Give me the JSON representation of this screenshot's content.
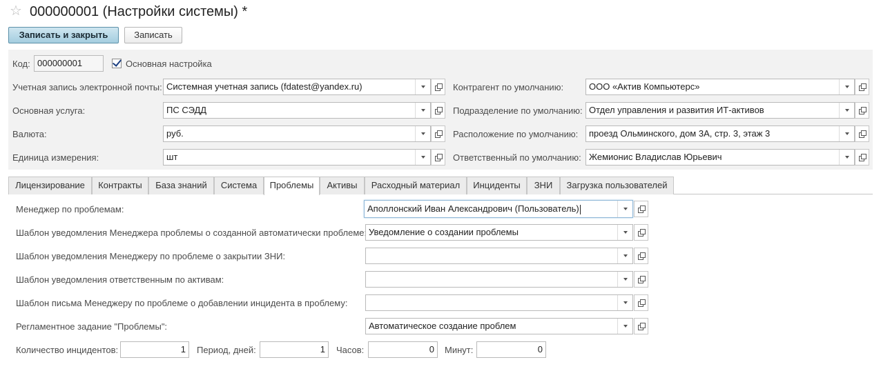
{
  "window": {
    "title": "000000001 (Настройки системы) *"
  },
  "toolbar": {
    "save_close_label": "Записать и закрыть",
    "save_label": "Записать"
  },
  "header": {
    "code_label": "Код:",
    "code_value": "000000001",
    "main_setting_label": "Основная настройка",
    "main_setting_checked": true,
    "left_fields": [
      {
        "label": "Учетная запись электронной почты:",
        "value": "Системная учетная запись (fdatest@yandex.ru)"
      },
      {
        "label": "Основная услуга:",
        "value": "ПС СЭДД"
      },
      {
        "label": "Валюта:",
        "value": "руб."
      },
      {
        "label": "Единица измерения:",
        "value": "шт"
      }
    ],
    "right_fields": [
      {
        "label": "Контрагент по умолчанию:",
        "value": "ООО «Актив Компьютерс»"
      },
      {
        "label": "Подразделение по умолчанию:",
        "value": "Отдел управления и развития ИТ-активов"
      },
      {
        "label": "Расположение по умолчанию:",
        "value": "проезд Ольминского, дом 3А, стр. 3, этаж 3"
      },
      {
        "label": "Ответственный по умолчанию:",
        "value": "Жемионис Владислав Юрьевич"
      }
    ]
  },
  "tabs": [
    {
      "label": "Лицензирование",
      "active": false
    },
    {
      "label": "Контракты",
      "active": false
    },
    {
      "label": "База знаний",
      "active": false
    },
    {
      "label": "Система",
      "active": false
    },
    {
      "label": "Проблемы",
      "active": true
    },
    {
      "label": "Активы",
      "active": false
    },
    {
      "label": "Расходный материал",
      "active": false
    },
    {
      "label": "Инциденты",
      "active": false
    },
    {
      "label": "ЗНИ",
      "active": false
    },
    {
      "label": "Загрузка пользователей",
      "active": false
    }
  ],
  "problems": {
    "fields": [
      {
        "label": "Менеджер по проблемам:",
        "value": "Аполлонский Иван Александрович (Пользователь)"
      },
      {
        "label": "Шаблон уведомления Менеджера проблемы о созданной автоматически проблеме:",
        "value": "Уведомление о создании проблемы"
      },
      {
        "label": "Шаблон уведомления Менеджеру по проблеме о закрытии ЗНИ:",
        "value": ""
      },
      {
        "label": "Шаблон уведомления ответственным по активам:",
        "value": ""
      },
      {
        "label": "Шаблон письма Менеджеру по проблеме о добавлении инцидента в проблему:",
        "value": ""
      },
      {
        "label": "Регламентное задание \"Проблемы\":",
        "value": "Автоматическое создание проблем"
      }
    ],
    "incident_count_label": "Количество инцидентов:",
    "incident_count_value": "1",
    "period_days_label": "Период, дней:",
    "period_days_value": "1",
    "hours_label": "Часов:",
    "hours_value": "0",
    "minutes_label": "Минут:",
    "minutes_value": "0"
  }
}
